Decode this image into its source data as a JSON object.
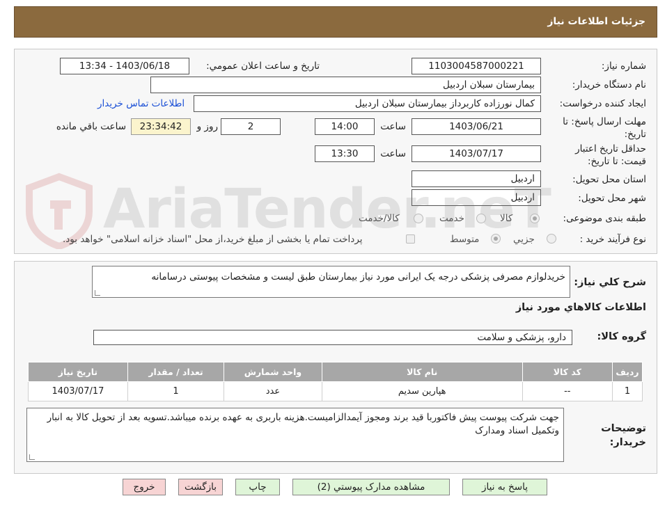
{
  "header": {
    "title": "جزئیات اطلاعات نیاز"
  },
  "form": {
    "need_number_label": "شماره نیاز:",
    "need_number": "1103004587000221",
    "announce_label": "تاریخ و ساعت اعلان عمومي:",
    "announce_value": "1403/06/18 - 13:34",
    "buyer_org_label": "نام دستگاه خريدار:",
    "buyer_org": "بیمارستان سبلان اردبیل",
    "creator_label": "ایجاد کننده درخواست:",
    "creator": "کمال نورزاده کاربرداز بیمارستان سبلان اردبیل",
    "contact_link": "اطلاعات تماس خريدار",
    "deadline_label": "مهلت ارسال پاسخ: تا تاریخ:",
    "deadline_date": "1403/06/21",
    "time_label": "ساعت",
    "deadline_time": "14:00",
    "days_value": "2",
    "days_label": "روز و",
    "remaining_time": "23:34:42",
    "remaining_label": "ساعت باقي مانده",
    "validity_label": "حداقل تاريخ اعتبار قيمت: تا تاریخ:",
    "validity_date": "1403/07/17",
    "validity_time_label": "ساعت",
    "validity_time": "13:30",
    "province_label": "استان محل تحویل:",
    "province": "اردبیل",
    "city_label": "شهر محل تحویل:",
    "city": "اردبیل",
    "category_label": "طبقه بندی موضوعی:",
    "category_options": [
      "کالا",
      "خدمت",
      "کالا/خدمت"
    ],
    "purchase_type_label": "نوع فرآیند خرید :",
    "purchase_type_options": [
      "جزيي",
      "متوسط"
    ],
    "purchase_note": "پرداخت تمام یا بخشی از مبلغ خرید،از محل \"اسناد خزانه اسلامی\" خواهد بود."
  },
  "description": {
    "label": "شرح کلي نياز:",
    "value": "خریدلوازم مصرفی پزشکی درجه یک ایرانی مورد نیاز بیمارستان طبق لیست و مشخصات پیوستی درسامانه"
  },
  "goods": {
    "section_title": "اطلاعات کالاهاي مورد نياز",
    "group_label": "گروه کالا:",
    "group_value": "دارو، پزشکی و سلامت",
    "columns": [
      "رديف",
      "کد کالا",
      "نام کالا",
      "واحد شمارش",
      "تعداد / مقدار",
      "تاريخ نياز"
    ],
    "rows": [
      {
        "row": "1",
        "code": "--",
        "name": "هپارین سدیم",
        "unit": "عدد",
        "qty": "1",
        "date": "1403/07/17"
      }
    ]
  },
  "buyer_notes": {
    "label": "توضيحات خريدار:",
    "value": "جهت شرکت پیوست پیش فاکتوربا قید برند ومجوز آیمدالزامیست.هزینه باربری به عهده برنده میباشد.تسویه بعد از تحویل کالا به انبار وتکمیل اسناد ومدارک"
  },
  "watermark": {
    "text": "AriaTender.neT"
  },
  "buttons": {
    "reply": "پاسخ به نیاز",
    "attachments": "مشاهده مدارک پیوستي (2)",
    "print": "چاپ",
    "back": "بازگشت",
    "exit": "خروج"
  },
  "colors": {
    "header": "#8b6a3e",
    "table_header": "#a7a7a7",
    "green_button": "#dff5d8",
    "red_button": "#f7d4d4",
    "link": "#1a4fd6"
  }
}
